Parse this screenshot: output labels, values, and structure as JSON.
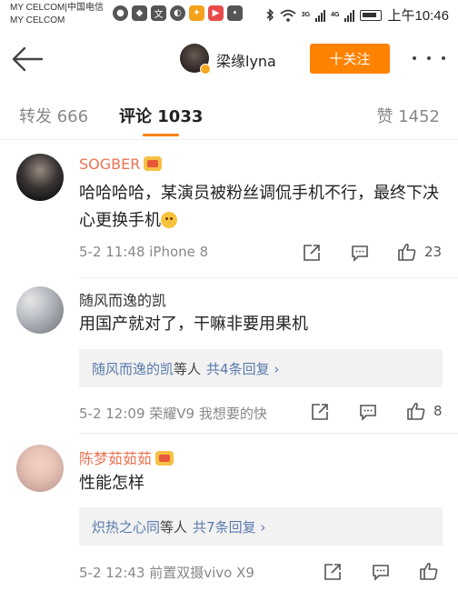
{
  "status_bar": {
    "carrier_line1": "MY CELCOM|中国电信",
    "carrier_line2": "MY CELCOM",
    "network_label_1": "3G",
    "network_label_2": "4G",
    "time": "上午10:46"
  },
  "header": {
    "username": "梁缘lyna",
    "follow_label": "十关注"
  },
  "tabs": {
    "repost": "转发 666",
    "comment": "评论 1033",
    "like": "赞 1452"
  },
  "comments": [
    {
      "name": "SOGBER",
      "text": "哈哈哈哈，某演员被粉丝调侃手机不行，最终下决心更换手机",
      "meta": "5-2 11:48  iPhone 8",
      "likes": "23"
    },
    {
      "name": "随风而逸的凯",
      "text": "用国产就对了，干嘛非要用果机",
      "reply_user": "随风而逸的凯",
      "reply_people": "等人",
      "reply_count": "共4条回复 ›",
      "meta": "5-2 12:09  荣耀V9 我想要的快",
      "likes": "8"
    },
    {
      "name": "陈梦茹茹茹",
      "text": "性能怎样",
      "reply_user": "炽热之心同",
      "reply_people": "等人",
      "reply_count": "共7条回复 ›",
      "meta": "5-2 12:43  前置双摄vivo X9",
      "likes": ""
    }
  ],
  "colors": {
    "accent": "#ff8200",
    "vip_name": "#eb7350",
    "link": "#5a7bab"
  }
}
